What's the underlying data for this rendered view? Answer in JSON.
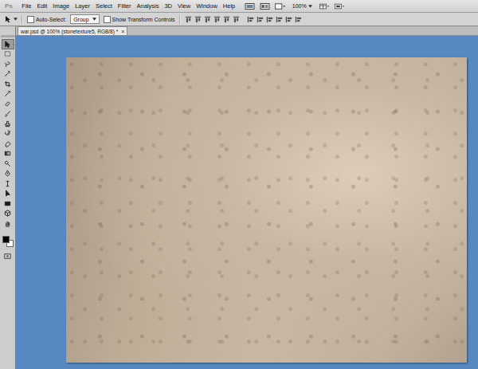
{
  "app": {
    "logo": "Ps"
  },
  "menu": [
    "File",
    "Edit",
    "Image",
    "Layer",
    "Select",
    "Filter",
    "Analysis",
    "3D",
    "View",
    "Window",
    "Help"
  ],
  "zoom": "100%",
  "options": {
    "auto_select": {
      "label": "Auto-Select:",
      "checked": false
    },
    "group": "Group",
    "transform": {
      "label": "Show Transform Controls",
      "checked": false
    }
  },
  "document_tab": {
    "title": "war.psd @ 100% (stonetexture5, RGB/8) *",
    "close": "×",
    "selected": true
  },
  "tools": [
    {
      "selected": true
    },
    {
      "selected": false
    },
    {
      "selected": false
    },
    {
      "selected": false
    },
    {
      "selected": false
    },
    {
      "selected": false
    },
    {
      "selected": false
    },
    {
      "selected": false
    },
    {
      "selected": false
    },
    {
      "selected": false
    },
    {
      "selected": false
    },
    {
      "selected": false
    },
    {
      "selected": false
    },
    {
      "selected": false
    },
    {
      "selected": false
    },
    {
      "selected": false
    },
    {
      "selected": false
    },
    {
      "selected": false
    },
    {
      "selected": false
    }
  ],
  "swatches": {
    "foreground": "#000000",
    "background": "#ffffff"
  }
}
